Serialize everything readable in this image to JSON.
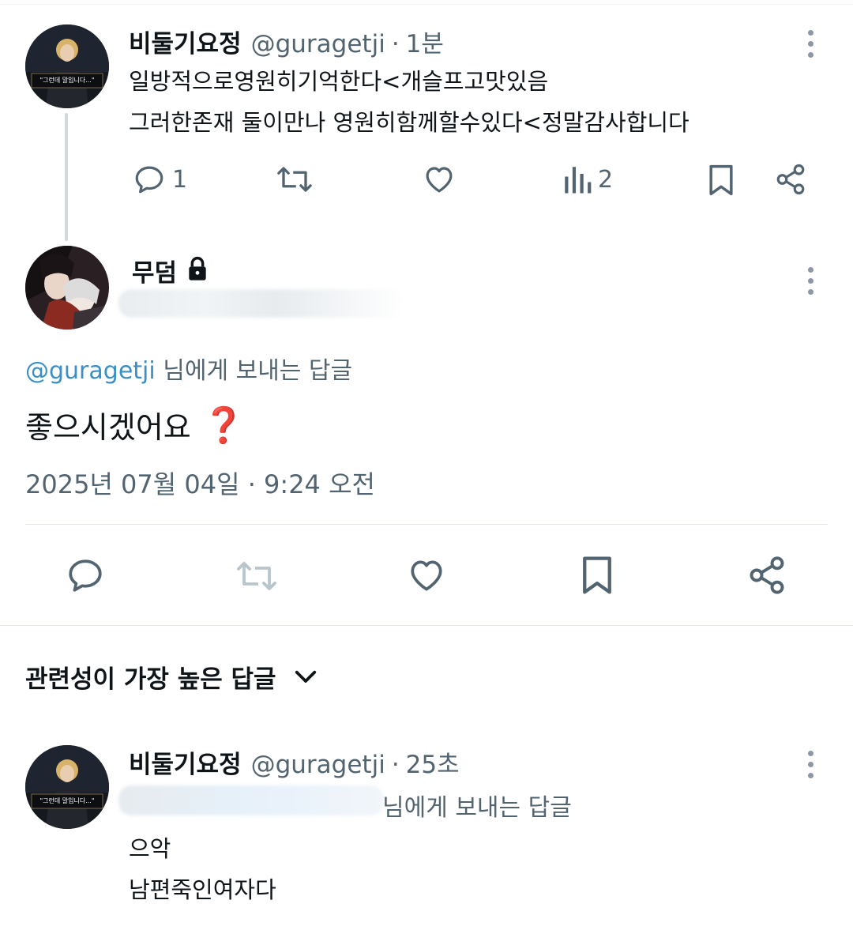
{
  "tweet1": {
    "display_name": "비둘기요정",
    "handle": "@guragetji",
    "dot": "·",
    "time": "1분",
    "avatar_caption": "\"그런데 말입니다...\"",
    "lines": [
      "일방적으로영원히기억한다<개슬프고맛있음",
      "그러한존재 둘이만나 영원히함께할수있다<정말감사합니다"
    ],
    "reply_count": "1",
    "view_count": "2"
  },
  "tweet2": {
    "display_name": "무덤",
    "reply_to_handle": "@guragetji",
    "reply_to_suffix": " 님에게 보내는 답글",
    "text": "좋으시겠어요",
    "emoji": "❓",
    "timestamp": "2025년 07월 04일 · 9:24 오전"
  },
  "sort": {
    "label": "관련성이 가장 높은 답글"
  },
  "reply": {
    "display_name": "비둘기요정",
    "handle": "@guragetji",
    "dot": "·",
    "time": "25초",
    "avatar_caption": "\"그런데 말입니다...\"",
    "reply_note": "님에게 보내는 답글",
    "lines": [
      "으악",
      "남편죽인여자다"
    ]
  },
  "icons": {
    "reply": "reply-icon",
    "retweet": "retweet-icon",
    "like": "heart-icon",
    "views": "views-icon",
    "bookmark": "bookmark-icon",
    "share": "share-icon",
    "more": "more-icon",
    "lock": "lock-icon",
    "chevron": "chevron-down-icon"
  },
  "colors": {
    "text": "#0f1419",
    "muted": "#536471",
    "mention": "#3a8fc7",
    "divider": "#dfe5e8",
    "question": "#e0245e"
  }
}
